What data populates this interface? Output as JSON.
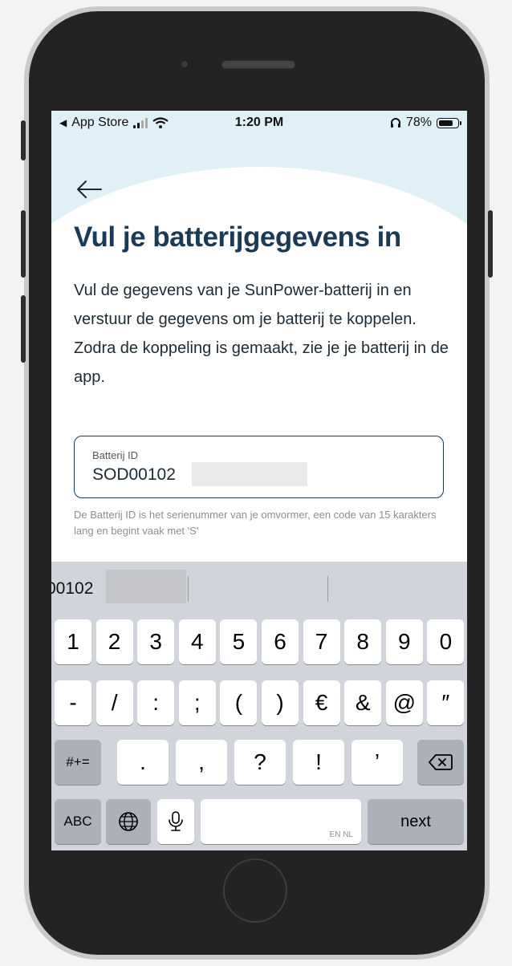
{
  "status_bar": {
    "back_app": "App Store",
    "time": "1:20 PM",
    "battery_pct": "78%",
    "battery_level": 0.78
  },
  "page": {
    "title": "Vul je batterijgegevens in",
    "description": "Vul de gegevens van je SunPower-batterij in en verstuur de gegevens om je batterij te koppelen. Zodra de koppeling is gemaakt, zie je je batterij in de app.",
    "input_label": "Batterij ID",
    "input_value": "SOD00102",
    "helper": "De Batterij ID is het serienummer van je omvormer, een code van 15 karakters lang en begint vaak met 'S'"
  },
  "keyboard": {
    "suggestion": "00102",
    "row1": [
      "1",
      "2",
      "3",
      "4",
      "5",
      "6",
      "7",
      "8",
      "9",
      "0"
    ],
    "row2": [
      "-",
      "/",
      ":",
      ";",
      "(",
      ")",
      "€",
      "&",
      "@",
      "″"
    ],
    "row3_left": "#+=",
    "row3": [
      ".",
      ",",
      "?",
      "!",
      "’"
    ],
    "abc_label": "ABC",
    "space_hint": "EN NL",
    "next_label": "next"
  },
  "colors": {
    "title": "#1a3a56",
    "hero": "#dff0f7",
    "keyboard": "#d1d4da"
  }
}
